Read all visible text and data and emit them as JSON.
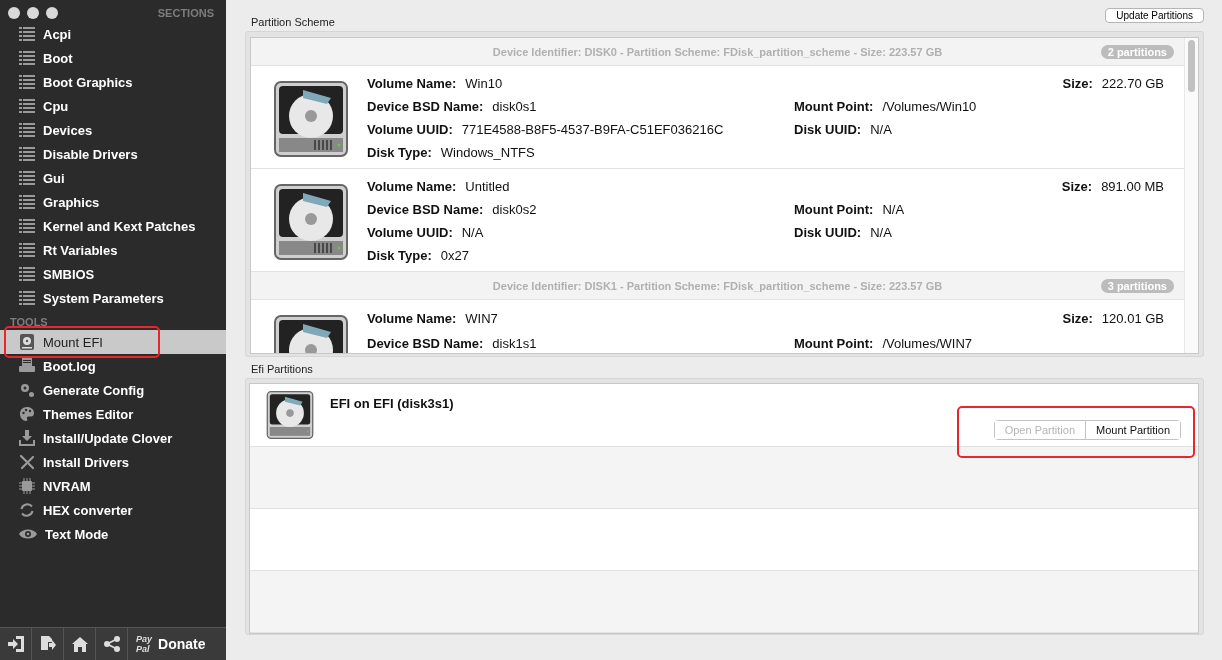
{
  "sidebar": {
    "sections_header": "SECTIONS",
    "sections": [
      {
        "label": "Acpi",
        "selected": false
      },
      {
        "label": "Boot",
        "selected": false
      },
      {
        "label": "Boot Graphics",
        "selected": false
      },
      {
        "label": "Cpu",
        "selected": false
      },
      {
        "label": "Devices",
        "selected": false
      },
      {
        "label": "Disable Drivers",
        "selected": false
      },
      {
        "label": "Gui",
        "selected": false
      },
      {
        "label": "Graphics",
        "selected": false
      },
      {
        "label": "Kernel and Kext Patches",
        "selected": false
      },
      {
        "label": "Rt Variables",
        "selected": false
      },
      {
        "label": "SMBIOS",
        "selected": false
      },
      {
        "label": "System Parameters",
        "selected": false
      }
    ],
    "tools_header": "TOOLS",
    "tools": [
      {
        "label": "Mount EFI",
        "selected": true,
        "highlighted": true
      },
      {
        "label": "Boot.log",
        "selected": false,
        "highlighted": false
      },
      {
        "label": "Generate Config",
        "selected": false,
        "highlighted": false
      },
      {
        "label": "Themes Editor",
        "selected": false,
        "highlighted": false
      },
      {
        "label": "Install/Update Clover",
        "selected": false,
        "highlighted": false
      },
      {
        "label": "Install Drivers",
        "selected": false,
        "highlighted": false
      },
      {
        "label": "NVRAM",
        "selected": false,
        "highlighted": false
      },
      {
        "label": "HEX converter",
        "selected": false,
        "highlighted": false
      },
      {
        "label": "Text Mode",
        "selected": false,
        "highlighted": false
      }
    ],
    "toolbar": {
      "paypal_top": "Pay",
      "paypal_bottom": "Pal",
      "donate": "Donate"
    }
  },
  "partition_scheme": {
    "title": "Partition Scheme",
    "update_button": "Update Partitions",
    "disks": [
      {
        "header": "Device Identifier: DISK0 - Partition Scheme: FDisk_partition_scheme - Size: 223.57 GB",
        "badge": "2 partitions",
        "partitions": [
          {
            "lines": [
              {
                "left": {
                  "label": "Volume Name:",
                  "value": "Win10"
                },
                "right": {
                  "label": "Size:",
                  "value": "222.70 GB"
                }
              },
              {
                "left": {
                  "label": "Device BSD Name:",
                  "value": "disk0s1"
                },
                "middle": {
                  "label": "Mount Point:",
                  "value": "/Volumes/Win10"
                }
              },
              {
                "left": {
                  "label": "Volume UUID:",
                  "value": "771E4588-B8F5-4537-B9FA-C51EF036216C"
                },
                "middle": {
                  "label": "Disk UUID:",
                  "value": "N/A"
                }
              },
              {
                "left": {
                  "label": "Disk Type:",
                  "value": "Windows_NTFS"
                }
              }
            ]
          },
          {
            "lines": [
              {
                "left": {
                  "label": "Volume Name:",
                  "value": "Untitled"
                },
                "right": {
                  "label": "Size:",
                  "value": "891.00 MB"
                }
              },
              {
                "left": {
                  "label": "Device BSD Name:",
                  "value": "disk0s2"
                },
                "middle": {
                  "label": "Mount Point:",
                  "value": "N/A"
                }
              },
              {
                "left": {
                  "label": "Volume UUID:",
                  "value": "N/A"
                },
                "middle": {
                  "label": "Disk UUID:",
                  "value": "N/A"
                }
              },
              {
                "left": {
                  "label": "Disk Type:",
                  "value": "0x27"
                }
              }
            ]
          }
        ]
      },
      {
        "header": "Device Identifier: DISK1 - Partition Scheme: FDisk_partition_scheme - Size: 223.57 GB",
        "badge": "3 partitions",
        "partitions": [
          {
            "lines": [
              {
                "left": {
                  "label": "Volume Name:",
                  "value": "WIN7"
                },
                "right": {
                  "label": "Size:",
                  "value": "120.01 GB"
                }
              },
              {
                "left": {
                  "label": "Device BSD Name:",
                  "value": "disk1s1"
                },
                "middle": {
                  "label": "Mount Point:",
                  "value": "/Volumes/WIN7"
                }
              }
            ]
          }
        ]
      }
    ]
  },
  "efi_partitions": {
    "title": "Efi Partitions",
    "items": [
      {
        "name": "EFI on EFI (disk3s1)",
        "highlighted": true,
        "buttons": [
          {
            "label": "Open Partition",
            "disabled": true
          },
          {
            "label": "Mount Partition",
            "disabled": false
          }
        ]
      }
    ]
  }
}
